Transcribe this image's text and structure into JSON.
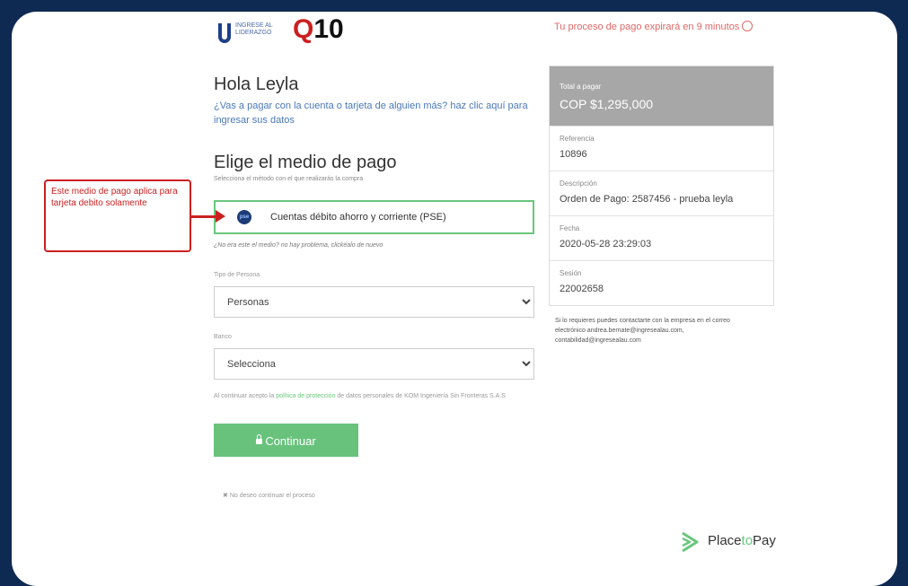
{
  "header": {
    "logo_left_text": "INGRESE AL LIDERAZGO",
    "logo_q_letter": "Q",
    "logo_q_rest": "10",
    "timer_text": "Tu proceso de pago expirará en 9 minutos"
  },
  "main": {
    "greeting": "Hola Leyla",
    "other_payer_link": "¿Vas a pagar con la cuenta o tarjeta de alguien más? haz clic aquí para ingresar sus datos",
    "method_title": "Elige el medio de pago",
    "method_subtitle": "Selecciona el método con el que realizarás la compra",
    "selected_method": {
      "icon_text": "pse",
      "label": "Cuentas débito ahorro y corriente (PSE)"
    },
    "not_method_text": "¿No era este el medio? no hay problema, clickéalo de nuevo",
    "person_type": {
      "label": "Tipo de Persona",
      "value": "Personas"
    },
    "bank": {
      "label": "Banco",
      "value": "Selecciona"
    },
    "terms": {
      "prefix": "Al continuar acepto la",
      "link": "política de protección",
      "suffix": "de datos personales de KOM Ingeniería Sin Fronteras S.A.S"
    },
    "continue_label": "Continuar",
    "cancel_text": "No deseo continuar el proceso"
  },
  "summary": {
    "total_label": "Total a pagar",
    "total_value": "COP $1,295,000",
    "rows": [
      {
        "label": "Referencia",
        "value": "10896"
      },
      {
        "label": "Descripción",
        "value": "Orden de Pago: 2587456 - prueba leyla"
      },
      {
        "label": "Fecha",
        "value": "2020-05-28 23:29:03"
      },
      {
        "label": "Sesión",
        "value": "22002658"
      }
    ],
    "contact": "Si lo requieres puedes contactarte con la empresa en el correo electrónico andrea.bernate@ingresealau.com, contabilidad@ingresealau.com"
  },
  "annotation": {
    "text": "Este medio de pago aplica para tarjeta debito solamente"
  },
  "footer": {
    "brand_part1": "Place",
    "brand_part2": "to",
    "brand_part3": "Pay"
  },
  "colors": {
    "accent_green": "#69c77c",
    "annotation_red": "#cc2020",
    "timer_red": "#e26868",
    "background_navy": "#0f2a52"
  }
}
